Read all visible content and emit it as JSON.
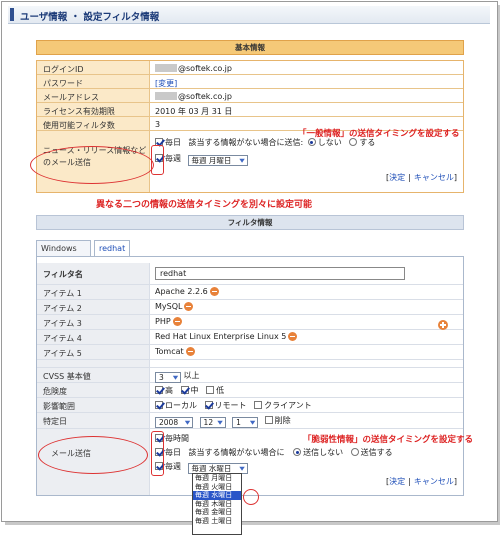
{
  "header": {
    "title": "ユーザ情報 ・ 設定フィルタ情報"
  },
  "basic": {
    "section_title": "基本情報",
    "rows": [
      {
        "label": "ログインID",
        "value": "@softek.co.jp"
      },
      {
        "label": "パスワード",
        "link": "[変更]"
      },
      {
        "label": "メールアドレス",
        "value": "@softek.co.jp"
      },
      {
        "label": "ライセンス有効期限",
        "value": "2010 年 03 月 31 日"
      },
      {
        "label": "使用可能フィルタ数",
        "value": "3"
      }
    ],
    "news_label": "ニュース・リリース情報などのメール送信",
    "daily": "毎日",
    "no_info_text": "該当する情報がない場合に送信:",
    "send_no": "しない",
    "send_yes": "する",
    "weekly": "毎週",
    "weekly_select": "毎週 月曜日",
    "confirm": "決定",
    "cancel": "キャンセル",
    "sep": "|",
    "lb": "[",
    "rb": "]"
  },
  "annotations": {
    "general": "「一般情報」の送信タイミングを設定する",
    "middle": "異なる二つの情報の送信タイミングを別々に設定可能",
    "vuln": "「脆弱性情報」の送信タイミングを設定する"
  },
  "filter": {
    "section_title": "フィルタ情報",
    "tabs": [
      "Windows ...",
      "redhat"
    ],
    "name_label": "フィルタ名",
    "name_value": "redhat",
    "items": [
      {
        "label": "アイテム 1",
        "value": "Apache 2.2.6"
      },
      {
        "label": "アイテム 2",
        "value": "MySQL"
      },
      {
        "label": "アイテム 3",
        "value": "PHP"
      },
      {
        "label": "アイテム 4",
        "value": "Red Hat Linux Enterprise Linux 5"
      },
      {
        "label": "アイテム 5",
        "value": "Tomcat"
      }
    ],
    "cvss_label": "CVSS 基本値",
    "cvss_value": "3",
    "cvss_suffix": "以上",
    "risk_label": "危険度",
    "risk": [
      "高",
      "中",
      "低"
    ],
    "scope_label": "影響範囲",
    "scope": [
      "ローカル",
      "リモート",
      "クライアント"
    ],
    "date_label": "特定日",
    "date": {
      "year": "2008",
      "month": "12",
      "day": "1",
      "delete": "削除"
    },
    "mail_label": "メール送信",
    "hourly": "毎時間",
    "daily": "毎日",
    "no_info_text": "該当する情報がない場合に",
    "send_no": "送信しない",
    "send_yes": "送信する",
    "weekly": "毎週",
    "weekly_select": "毎週 水曜日",
    "dropdown": [
      "毎週 月曜日",
      "毎週 火曜日",
      "毎週 水曜日",
      "毎週 木曜日",
      "毎週 金曜日",
      "毎週 土曜日"
    ],
    "confirm": "決定",
    "cancel": "キャンセル"
  },
  "colors": {
    "accent": "#1f4fb8",
    "annotation": "#d22",
    "section_orange": "#f5c978"
  }
}
